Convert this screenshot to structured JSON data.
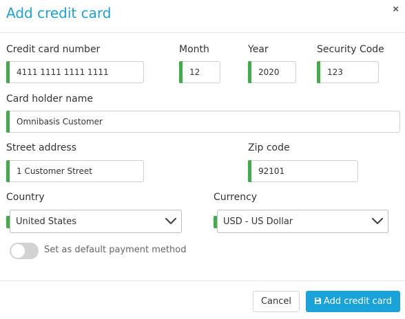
{
  "dialog": {
    "title": "Add credit card",
    "close_glyph": "×"
  },
  "form": {
    "card_number": {
      "label": "Credit card number",
      "value": "4111 1111 1111 1111"
    },
    "month": {
      "label": "Month",
      "value": "12"
    },
    "year": {
      "label": "Year",
      "value": "2020"
    },
    "security_code": {
      "label": "Security Code",
      "value": "123"
    },
    "card_holder": {
      "label": "Card holder name",
      "value": "Omnibasis Customer"
    },
    "street": {
      "label": "Street address",
      "value": "1 Customer Street"
    },
    "zip": {
      "label": "Zip code",
      "value": "92101"
    },
    "country": {
      "label": "Country",
      "value": "United States"
    },
    "currency": {
      "label": "Currency",
      "value": "USD - US Dollar"
    },
    "default_toggle": {
      "label": "Set as default payment method",
      "checked": false
    }
  },
  "footer": {
    "cancel_label": "Cancel",
    "submit_label": "Add credit card",
    "submit_icon": "floppy-disk-icon"
  },
  "colors": {
    "accent": "#1aa3d9",
    "valid_indicator": "#3fae49",
    "toggle_off": "#d2d2d2"
  }
}
